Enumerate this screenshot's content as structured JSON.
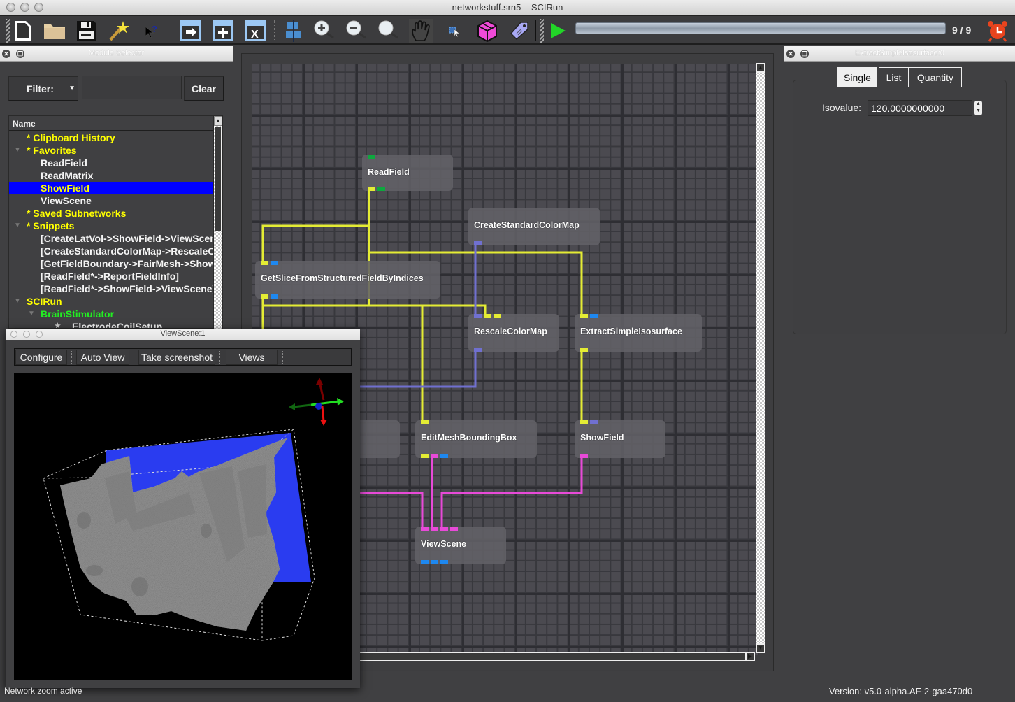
{
  "window": {
    "title": "networkstuff.srn5 – SCIRun"
  },
  "toolbar": {
    "buttons": [
      {
        "name": "new-network-icon"
      },
      {
        "name": "open-folder-icon"
      },
      {
        "name": "save-icon"
      },
      {
        "name": "magic-wand-icon"
      },
      {
        "name": "whats-this-help-icon"
      },
      {
        "name": "dock-arrow-icon"
      },
      {
        "name": "dock-add-icon"
      },
      {
        "name": "dock-close-icon"
      },
      {
        "name": "align-modules-icon"
      },
      {
        "name": "zoom-in-icon"
      },
      {
        "name": "zoom-out-icon"
      },
      {
        "name": "zoom-reset-icon"
      },
      {
        "name": "pan-hand-icon"
      },
      {
        "name": "select-region-icon"
      },
      {
        "name": "pink-cube-icon"
      },
      {
        "name": "tag-icon"
      },
      {
        "name": "execute-play-icon"
      }
    ],
    "progress_fraction": 1.0,
    "progress_text": "9 / 9",
    "alarm_icon": "alarm-clock-icon"
  },
  "module_selector": {
    "title": "Module Selector",
    "filter_label": "Filter:",
    "filter_value": "",
    "clear_label": "Clear",
    "column_header": "Name",
    "items": [
      {
        "label": "* Clipboard History",
        "indent": 1,
        "color": "#ffff00",
        "arrow": ""
      },
      {
        "label": "* Favorites",
        "indent": 1,
        "color": "#ffff00",
        "arrow": "▼"
      },
      {
        "label": "ReadField",
        "indent": 2,
        "color": "#f4f4f4",
        "arrow": ""
      },
      {
        "label": "ReadMatrix",
        "indent": 2,
        "color": "#f4f4f4",
        "arrow": ""
      },
      {
        "label": "ShowField",
        "indent": 2,
        "color": "#ffff00",
        "arrow": "",
        "selected": true
      },
      {
        "label": "ViewScene",
        "indent": 2,
        "color": "#f4f4f4",
        "arrow": ""
      },
      {
        "label": "* Saved Subnetworks",
        "indent": 1,
        "color": "#ffff00",
        "arrow": ""
      },
      {
        "label": "* Snippets",
        "indent": 1,
        "color": "#ffff00",
        "arrow": "▼"
      },
      {
        "label": "[CreateLatVol->ShowField->ViewScene]",
        "indent": 2,
        "color": "#f4f4f4",
        "arrow": ""
      },
      {
        "label": "[CreateStandardColorMap->RescaleColorMap]",
        "indent": 2,
        "color": "#f4f4f4",
        "arrow": ""
      },
      {
        "label": "[GetFieldBoundary->FairMesh->ShowField]",
        "indent": 2,
        "color": "#f4f4f4",
        "arrow": ""
      },
      {
        "label": "[ReadField*->ReportFieldInfo]",
        "indent": 2,
        "color": "#f4f4f4",
        "arrow": ""
      },
      {
        "label": "[ReadField*->ShowField->ViewScene]",
        "indent": 2,
        "color": "#f4f4f4",
        "arrow": ""
      },
      {
        "label": "SCIRun",
        "indent": 1,
        "color": "#ffff00",
        "arrow": "▼"
      },
      {
        "label": "BrainStimulator",
        "indent": 2,
        "color": "#22ee22",
        "arrow": "▼"
      },
      {
        "label": "ElectrodeCoilSetup",
        "indent": 3,
        "color": "#f4f4f4",
        "arrow": "★"
      }
    ]
  },
  "network": {
    "modules": [
      {
        "id": "readfield",
        "label": "ReadField"
      },
      {
        "id": "createstandardcolormap",
        "label": "CreateStandardColorMap"
      },
      {
        "id": "getslice",
        "label": "GetSliceFromStructuredFieldByIndices"
      },
      {
        "id": "rescalecolormap",
        "label": "RescaleColorMap"
      },
      {
        "id": "extractsimpleisosurface",
        "label": "ExtractSimpleIsosurface"
      },
      {
        "id": "hidden-module",
        "label": ""
      },
      {
        "id": "editmeshboundingbox",
        "label": "EditMeshBoundingBox"
      },
      {
        "id": "showfield",
        "label": "ShowField"
      },
      {
        "id": "viewscene",
        "label": "ViewScene"
      }
    ],
    "port_colors": {
      "field": "#e4ec34",
      "matrix": "#0ea83e",
      "geometry": "#e84ad8",
      "colormap": "#7070d0",
      "dynamic": "#1e88f0"
    },
    "connections": [
      {
        "from": "ReadField",
        "to": "GetSliceFromStructuredFieldByIndices",
        "type": "field"
      },
      {
        "from": "ReadField",
        "to": "ExtractSimpleIsosurface",
        "type": "field"
      },
      {
        "from": "ReadField",
        "to": "RescaleColorMap",
        "type": "field"
      },
      {
        "from": "GetSliceFromStructuredFieldByIndices",
        "to": "RescaleColorMap",
        "type": "field"
      },
      {
        "from": "GetSliceFromStructuredFieldByIndices",
        "to": "EditMeshBoundingBox",
        "type": "field"
      },
      {
        "from": "CreateStandardColorMap",
        "to": "RescaleColorMap",
        "type": "colormap"
      },
      {
        "from": "RescaleColorMap",
        "to": "hidden-module",
        "type": "colormap"
      },
      {
        "from": "ExtractSimpleIsosurface",
        "to": "ShowField",
        "type": "field"
      },
      {
        "from": "EditMeshBoundingBox",
        "to": "ViewScene",
        "type": "geometry"
      },
      {
        "from": "ShowField",
        "to": "ViewScene",
        "type": "geometry"
      },
      {
        "from": "hidden-module",
        "to": "ViewScene",
        "type": "geometry"
      }
    ]
  },
  "module_ui": {
    "title": "ExtractSimpleIsosurface:0",
    "tabs": [
      {
        "label": "Single",
        "active": true
      },
      {
        "label": "List",
        "active": false
      },
      {
        "label": "Quantity",
        "active": false
      }
    ],
    "isovalue_label": "Isovalue:",
    "isovalue": "120.0000000000"
  },
  "viewscene": {
    "title": "ViewScene:1",
    "buttons": [
      "Configure",
      "Auto View",
      "Take screenshot",
      "Views"
    ],
    "axes": {
      "x": "#22dd22",
      "y": "#7a0000",
      "z": "#ee1111",
      "origin": "#1122cc"
    },
    "slice_color": "#2a3cf0",
    "surface_color": "#9a9a9a"
  },
  "status": {
    "left": "Network zoom active",
    "version": "Version: v5.0-alpha.AF-2-gaa470d0"
  }
}
